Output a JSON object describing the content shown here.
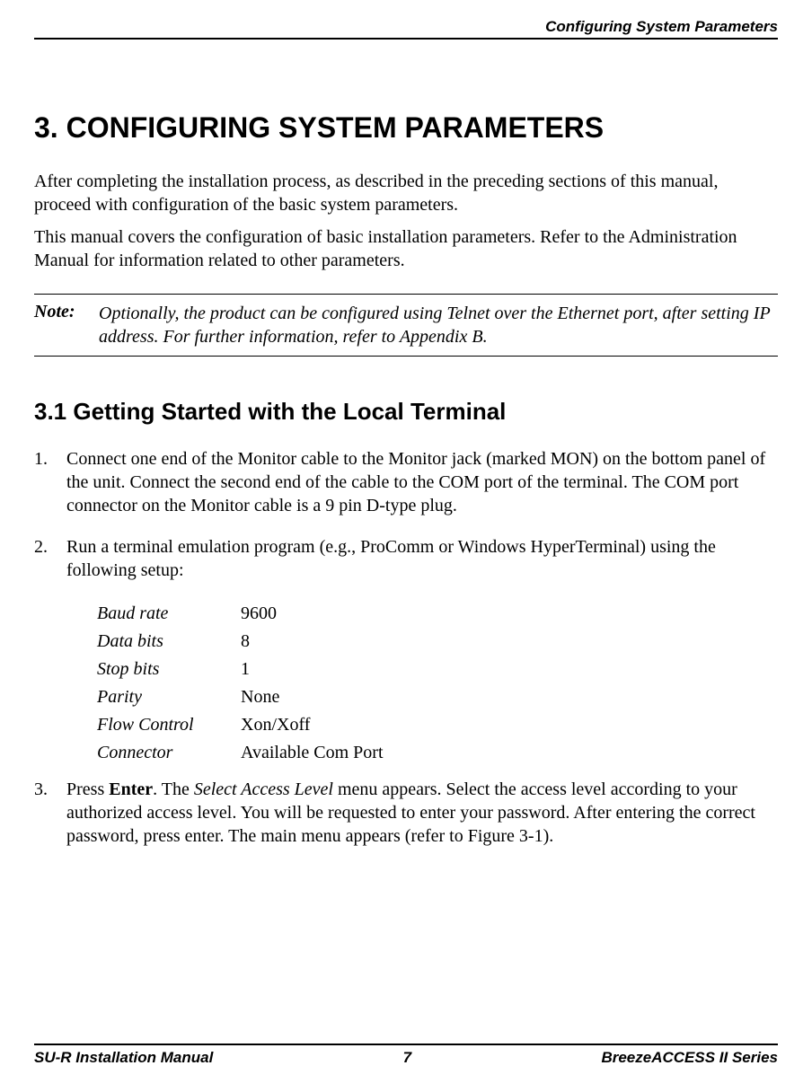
{
  "header": {
    "running_title": "Configuring System Parameters"
  },
  "section": {
    "number": "3.",
    "title": "CONFIGURING SYSTEM PARAMETERS",
    "intro_p1": "After completing the installation process, as described in the preceding sections of this manual, proceed with configuration of the basic system parameters.",
    "intro_p2": "This manual covers the configuration of basic installation parameters. Refer to the Administration Manual for information related to other parameters."
  },
  "note": {
    "label": "Note:",
    "text": "Optionally, the product can be configured using Telnet over the Ethernet port, after setting IP address. For further information, refer to Appendix B."
  },
  "subsection": {
    "number": "3.1",
    "title": "Getting Started with the Local Terminal"
  },
  "steps": {
    "s1_num": "1.",
    "s1_text": "Connect one end of the Monitor cable to the Monitor jack (marked MON) on the bottom panel of the unit. Connect the second end of the cable to the COM port of the terminal. The COM port connector on the Monitor cable is a 9 pin D-type plug.",
    "s2_num": "2.",
    "s2_text": "Run a terminal emulation program (e.g., ProComm or Windows HyperTerminal) using the following setup:",
    "s3_num": "3.",
    "s3_pre": "Press ",
    "s3_bold": "Enter",
    "s3_mid1": ". The ",
    "s3_italic": "Select Access Level",
    "s3_mid2": " menu appears. Select the access level according to your authorized access level. You will be requested to enter your password. After entering the correct password, press enter. The main menu appears (refer to Figure 3-1)."
  },
  "setup": [
    {
      "label": "Baud rate",
      "value": "9600"
    },
    {
      "label": "Data bits",
      "value": "8"
    },
    {
      "label": "Stop bits",
      "value": "1"
    },
    {
      "label": "Parity",
      "value": "None"
    },
    {
      "label": "Flow Control",
      "value": "Xon/Xoff"
    },
    {
      "label": "Connector",
      "value": "Available Com Port"
    }
  ],
  "footer": {
    "left": "SU-R Installation Manual",
    "center": "7",
    "right": "BreezeACCESS II Series"
  }
}
